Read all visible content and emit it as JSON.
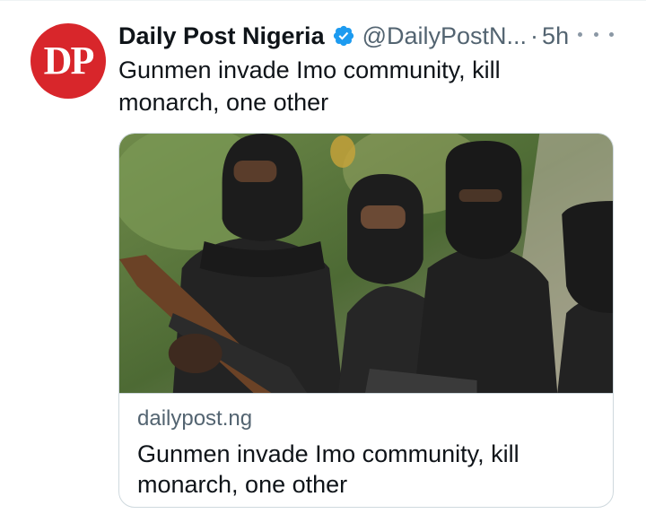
{
  "tweet": {
    "avatar_text": "DP",
    "display_name": "Daily Post Nigeria",
    "handle": "@DailyPostN...",
    "separator": "·",
    "time": "5h",
    "text": "Gunmen invade Imo community, kill monarch, one other",
    "more_icon": "more-horizontal-icon",
    "verified_icon": "verified-badge-icon"
  },
  "card": {
    "image_subject": "masked gunmen in black balaclavas holding rifles",
    "domain": "dailypost.ng",
    "title": "Gunmen invade Imo community, kill monarch, one other"
  },
  "colors": {
    "avatar_bg": "#d8262b",
    "verified_blue": "#1d9bf0",
    "secondary_text": "#536471",
    "border": "#cfd9de"
  }
}
